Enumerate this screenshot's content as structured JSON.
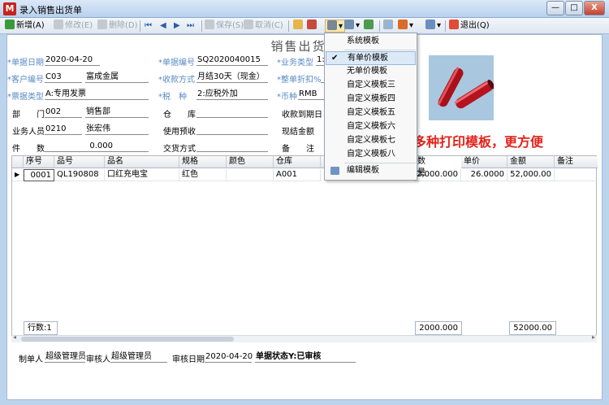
{
  "window": {
    "title": "录入销售出货单",
    "app_icon": "M",
    "minimize": "—",
    "maximize": "□",
    "close": "X"
  },
  "toolbar": {
    "new": "新增(A)",
    "modify": "修改(E)",
    "delete": "删除(D)",
    "save": "保存(S)",
    "cancel": "取消(C)",
    "exit": "退出(Q)"
  },
  "doc": {
    "title": "销售出货单"
  },
  "form": {
    "date_label": "*单据日期",
    "date": "2020-04-20",
    "docno_label": "*单据编号",
    "docno": "SQ2020040015",
    "biztype_label": "*业务类型",
    "biztype": "1:",
    "cust_label": "*客户编号",
    "cust_code": "C03",
    "cust_name": "富成金属",
    "paymode_label": "*收款方式",
    "paymode": "月结30天（现金）",
    "discount_label": "*整单折扣%",
    "invoice_label": "*票据类型",
    "invoice": "A:专用发票",
    "tax_label": "*税　种",
    "tax": "2:应税外加",
    "currency_label": "*币种",
    "currency": "RMB",
    "dept_label": "部　　门",
    "dept_code": "002",
    "dept_name": "销售部",
    "wh_label": "仓　　库",
    "due_label": "收款到期日",
    "sales_label": "业务人员",
    "sales_code": "0210",
    "sales_name": "张宏伟",
    "prepay_label": "使用预收",
    "cash_label": "现结金额",
    "count_label": "件　　数",
    "count": "0.000",
    "delivery_label": "交货方式",
    "remark_label": "备　　注"
  },
  "grid": {
    "headers": [
      "序号",
      "品号",
      "品名",
      "规格",
      "颜色",
      "仓库",
      "数量",
      "单价",
      "金额",
      "备注"
    ],
    "rows": [
      {
        "seq": "0001",
        "code": "QL190808",
        "name": "口红充电宝",
        "spec": "红色",
        "color": "",
        "wh": "A001",
        "qty": "2,000.000",
        "price": "26.0000",
        "amount": "52,000.00",
        "note": ""
      }
    ]
  },
  "footer": {
    "rowcount": "行数:1",
    "total_qty": "2000.000",
    "total_amount": "52000.00"
  },
  "bottom": {
    "maker_label": "制单人",
    "maker": "超级管理员",
    "auditor_label": "审核人",
    "auditor": "超级管理员",
    "auditdate_label": "审核日期",
    "auditdate": "2020-04-20",
    "status": "单据状态Y:已审核"
  },
  "menu": {
    "items": [
      "系统模板",
      "有单价模板",
      "无单价模板",
      "自定义模板三",
      "自定义模板四",
      "自定义模板五",
      "自定义模板六",
      "自定义模板七",
      "自定义模板八",
      "编辑模板"
    ],
    "selected_mark": "✔"
  },
  "promo": "支持多种打印模板，更方便"
}
